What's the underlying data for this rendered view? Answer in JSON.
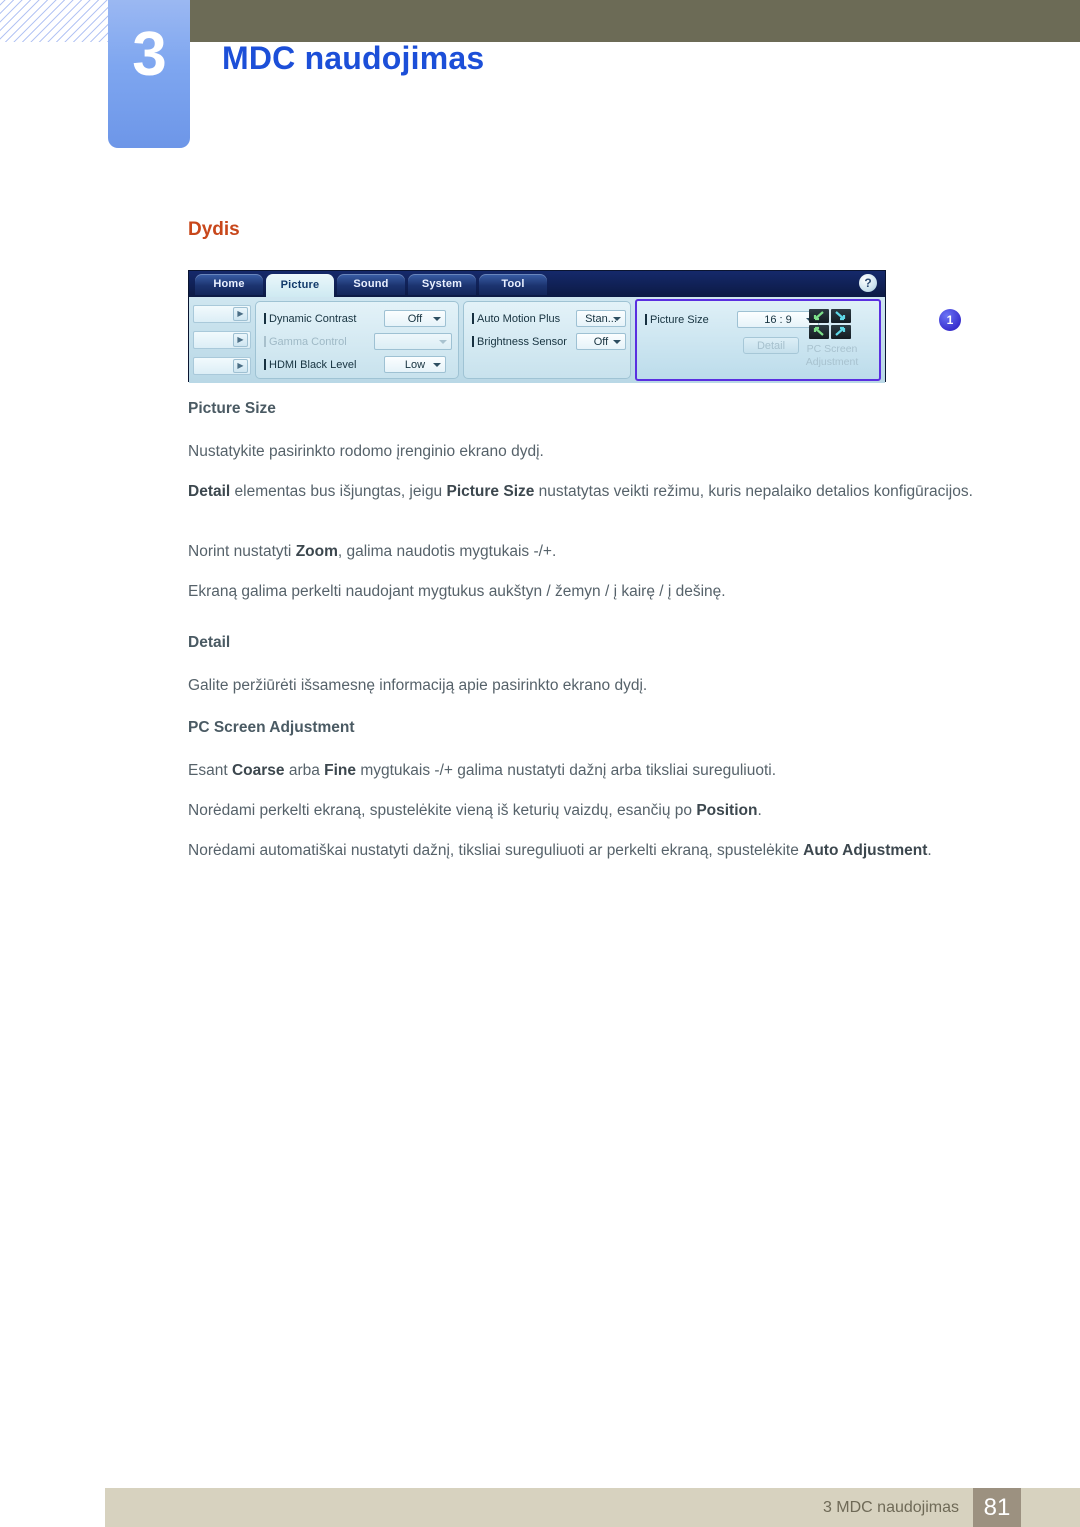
{
  "chapter": {
    "number": "3",
    "title": "MDC naudojimas"
  },
  "section": {
    "heading": "Dydis"
  },
  "mdc_screenshot": {
    "tabs": [
      {
        "label": "Home",
        "active": false
      },
      {
        "label": "Picture",
        "active": true
      },
      {
        "label": "Sound",
        "active": false
      },
      {
        "label": "System",
        "active": false
      },
      {
        "label": "Tool",
        "active": false
      }
    ],
    "help_icon": "?",
    "rail_arrow_icon": "▶",
    "group_left": {
      "rows": [
        {
          "label": "Dynamic Contrast",
          "value": "Off",
          "disabled": false
        },
        {
          "label": "Gamma Control",
          "value": "",
          "disabled": true
        },
        {
          "label": "HDMI Black Level",
          "value": "Low",
          "disabled": false
        }
      ]
    },
    "group_middle": {
      "rows": [
        {
          "label": "Auto Motion Plus",
          "value": "Stan...",
          "disabled": false
        },
        {
          "label": "Brightness Sensor",
          "value": "Off",
          "disabled": false
        }
      ]
    },
    "group_right": {
      "callout_badge": "1",
      "picture_size_label": "Picture Size",
      "picture_size_value": "16 : 9",
      "detail_button": "Detail",
      "pc_screen_adjustment_line1": "PC Screen",
      "pc_screen_adjustment_line2": "Adjustment",
      "pcsa_icon": "four-direction-arrows-icon"
    }
  },
  "content": {
    "picture_size_heading": "Picture Size",
    "p1": "Nustatykite pasirinkto rodomo įrenginio ekrano dydį.",
    "p2_a": "Detail",
    "p2_b": " elementas bus išjungtas, jeigu ",
    "p2_c": "Picture Size",
    "p2_d": " nustatytas veikti režimu, kuris nepalaiko detalios konfigūracijos.",
    "p3_a": "Norint nustatyti ",
    "p3_b": "Zoom",
    "p3_c": ", galima naudotis mygtukais -/+.",
    "p4": "Ekraną galima perkelti naudojant mygtukus aukštyn / žemyn / į kairę / į dešinę.",
    "detail_heading": "Detail",
    "p5": "Galite peržiūrėti išsamesnę informaciją apie pasirinkto ekrano dydį.",
    "pcsa_heading": "PC Screen Adjustment",
    "p6_a": "Esant ",
    "p6_b": "Coarse",
    "p6_c": " arba ",
    "p6_d": "Fine",
    "p6_e": " mygtukais -/+ galima nustatyti dažnį arba tiksliai sureguliuoti.",
    "p7_a": "Norėdami perkelti ekraną, spustelėkite vieną iš keturių vaizdų, esančių po ",
    "p7_b": "Position",
    "p7_c": ".",
    "p8_a": "Norėdami automatiškai nustatyti dažnį, tiksliai sureguliuoti ar perkelti ekraną, spustelėkite ",
    "p8_b": "Auto Adjustment",
    "p8_c": "."
  },
  "footer": {
    "text": "3 MDC naudojimas",
    "page_number": "81"
  },
  "colors": {
    "chapter_title": "#1c4fd8",
    "section_heading": "#c8471b",
    "olive_bar": "#6c6b56",
    "footer_bar": "#d7d2bf",
    "page_box": "#9c9180",
    "callout": "#3a31cf"
  }
}
